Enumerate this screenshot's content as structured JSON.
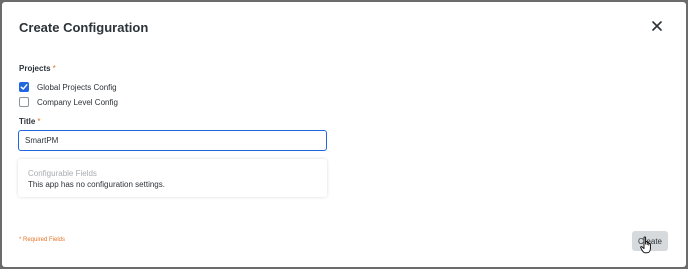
{
  "dialog": {
    "title": "Create Configuration",
    "close_icon": "close-icon"
  },
  "projects": {
    "label": "Projects",
    "required_mark": "*",
    "options": [
      {
        "label": "Global Projects Config",
        "checked": true
      },
      {
        "label": "Company Level Config",
        "checked": false
      }
    ]
  },
  "title_field": {
    "label": "Title",
    "required_mark": "*",
    "value": "SmartPM"
  },
  "configurable_fields": {
    "heading": "Configurable Fields",
    "message": "This app has no configuration settings."
  },
  "footer": {
    "required_note": "* Required Fields",
    "create_label": "Create"
  },
  "colors": {
    "accent": "#2066df",
    "required": "#e5752a",
    "overlay": "#6b6b6b"
  }
}
